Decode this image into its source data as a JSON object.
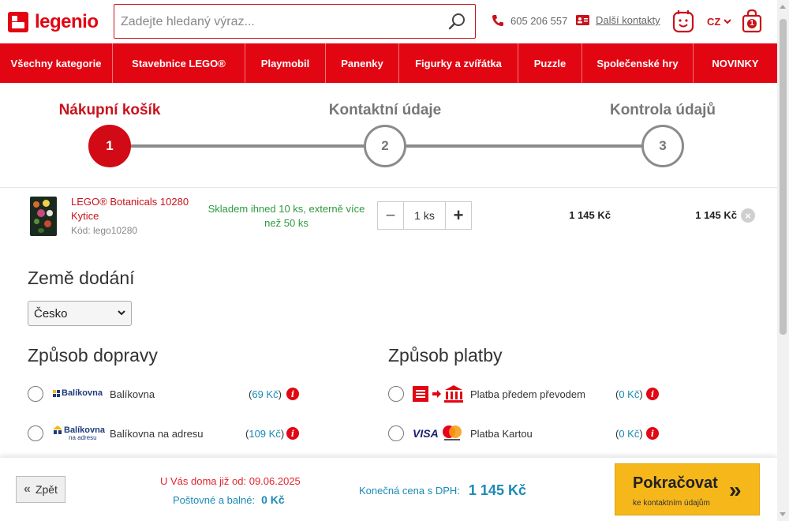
{
  "header": {
    "brand": "legenio",
    "search_placeholder": "Zadejte hledaný výraz...",
    "phone": "605 206 557",
    "contacts_label": "Další kontakty",
    "language": "CZ",
    "cart_count": "1"
  },
  "nav": {
    "items": [
      {
        "label": "Všechny kategorie"
      },
      {
        "label": "Stavebnice LEGO®"
      },
      {
        "label": "Playmobil"
      },
      {
        "label": "Panenky"
      },
      {
        "label": "Figurky a zvířátka"
      },
      {
        "label": "Puzzle"
      },
      {
        "label": "Společenské hry"
      },
      {
        "label": "NOVINKY"
      }
    ]
  },
  "steps": [
    {
      "label": "Nákupní košík",
      "number": "1",
      "active": true
    },
    {
      "label": "Kontaktní údaje",
      "number": "2",
      "active": false
    },
    {
      "label": "Kontrola údajů",
      "number": "3",
      "active": false
    }
  ],
  "cart": {
    "product_name": "LEGO® Botanicals 10280 Kytice",
    "product_code": "Kód: lego10280",
    "stock": "Skladem ihned 10 ks, externě více než 50 ks",
    "quantity": "1 ks",
    "unit_price": "1 145 Kč",
    "total_price": "1 145 Kč"
  },
  "country": {
    "title": "Země dodání",
    "selected": "Česko"
  },
  "shipping": {
    "title": "Způsob dopravy",
    "options": [
      {
        "logo": "Balíkovna",
        "label": "Balíkovna",
        "price": "69 Kč"
      },
      {
        "logo": "Balíkovna",
        "logo_sub": "na adresu",
        "label": "Balíkovna na adresu",
        "price": "109 Kč"
      }
    ]
  },
  "payment": {
    "title": "Způsob platby",
    "options": [
      {
        "label": "Platba předem převodem",
        "price": "0 Kč"
      },
      {
        "logo": "VISA",
        "label": "Platba Kartou",
        "price": "0 Kč"
      }
    ]
  },
  "footer": {
    "back_label": "Zpět",
    "delivery_text": "U Vás doma již od: 09.06.2025",
    "shipping_label": "Poštovné a balné:",
    "shipping_value": "0 Kč",
    "final_label": "Konečná cena s DPH:",
    "final_value": "1 145 Kč",
    "continue_label": "Pokračovat",
    "continue_sub": "ke kontaktním údajům"
  },
  "colors": {
    "brand_red": "#e20613",
    "accent_blue": "#1b8ab5",
    "stock_green": "#2e9a3e",
    "cta_yellow": "#f6b71b"
  }
}
